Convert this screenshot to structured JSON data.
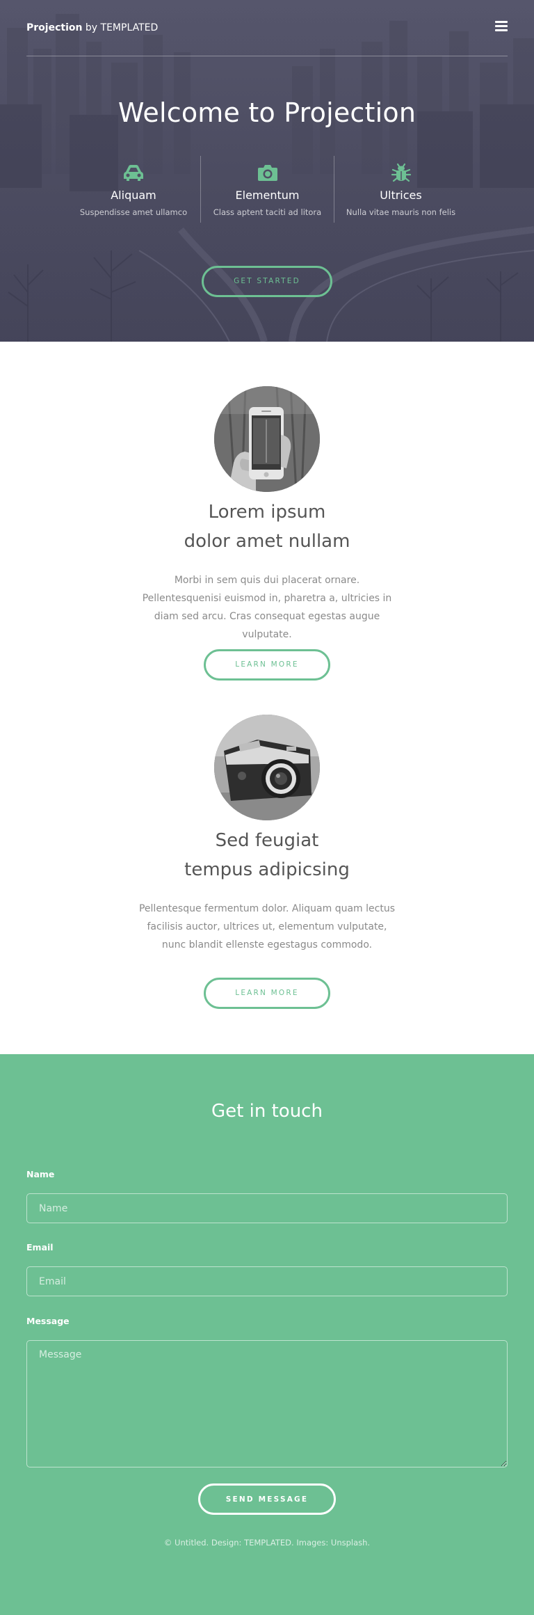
{
  "header": {
    "brand_bold": "Projection",
    "brand_rest": " by TEMPLATED",
    "menu_icon": "hamburger-icon"
  },
  "banner": {
    "title": "Welcome to Projection",
    "features": [
      {
        "icon": "car-icon",
        "title": "Aliquam",
        "description": "Suspendisse amet ullamco"
      },
      {
        "icon": "camera-icon",
        "title": "Elementum",
        "description": "Class aptent taciti ad litora"
      },
      {
        "icon": "bug-icon",
        "title": "Ultrices",
        "description": "Nulla vitae mauris non felis"
      }
    ],
    "cta_label": "GET STARTED"
  },
  "spotlights": [
    {
      "image": "phone-photo",
      "title_line1": "Lorem ipsum",
      "title_line2": "dolor amet nullam",
      "text": "Morbi in sem quis dui placerat ornare. Pellentesquenisi euismod in, pharetra a, ultricies in diam sed arcu. Cras consequat egestas augue vulputate.",
      "button": "LEARN MORE"
    },
    {
      "image": "camera-photo",
      "title_line1": "Sed feugiat",
      "title_line2": "tempus adipicsing",
      "text": "Pellentesque fermentum dolor. Aliquam quam lectus facilisis auctor, ultrices ut, elementum vulputate, nunc blandit ellenste egestagus commodo.",
      "button": "LEARN MORE"
    }
  ],
  "contact": {
    "heading": "Get in touch",
    "name_label": "Name",
    "name_placeholder": "Name",
    "email_label": "Email",
    "email_placeholder": "Email",
    "message_label": "Message",
    "message_placeholder": "Message",
    "submit": "SEND MESSAGE"
  },
  "footer": {
    "copy_prefix": "© Untitled. Design: ",
    "design_link": "TEMPLATED",
    "images_prefix": ". Images: ",
    "images_link": "Unsplash",
    "copy_suffix": "."
  },
  "colors": {
    "accent": "#6dc093",
    "banner_overlay": "#4d4d62",
    "text": "#555555"
  }
}
